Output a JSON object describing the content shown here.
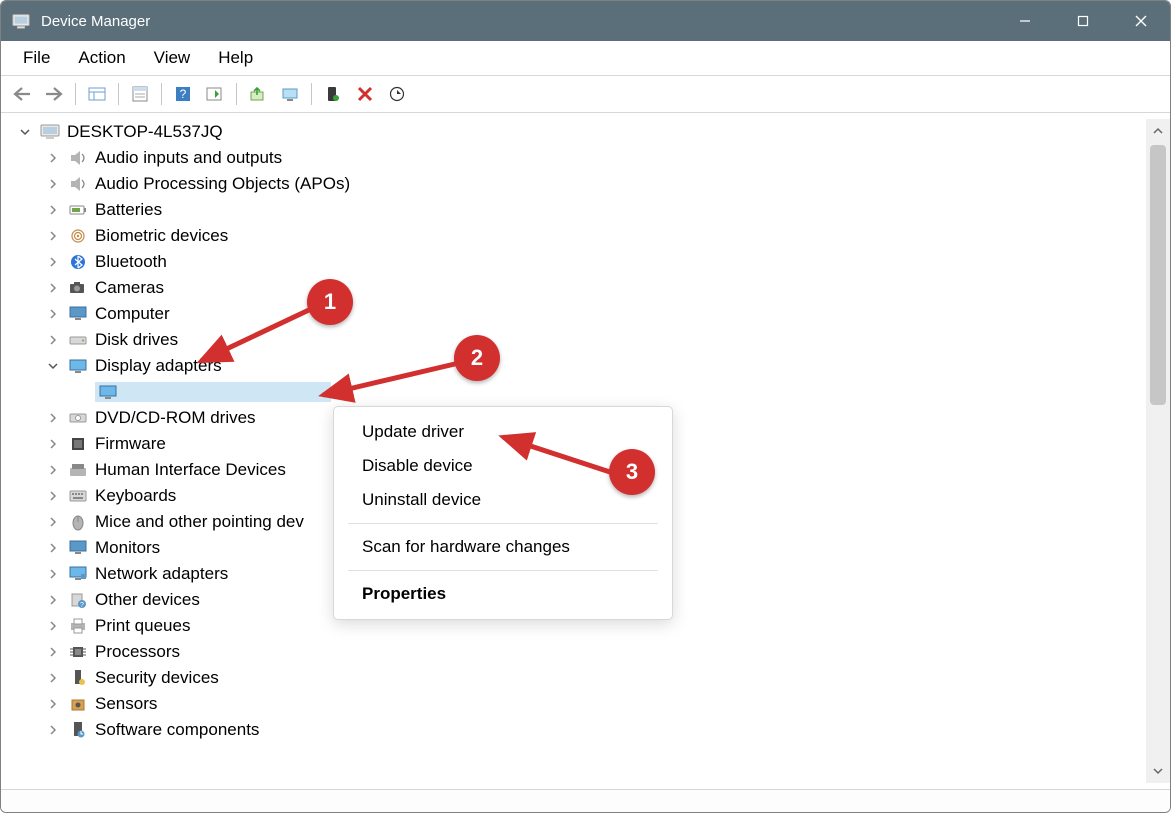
{
  "window": {
    "title": "Device Manager"
  },
  "menus": {
    "file": "File",
    "action": "Action",
    "view": "View",
    "help": "Help"
  },
  "tree": {
    "root": "DESKTOP-4L537JQ",
    "items": [
      "Audio inputs and outputs",
      "Audio Processing Objects (APOs)",
      "Batteries",
      "Biometric devices",
      "Bluetooth",
      "Cameras",
      "Computer",
      "Disk drives",
      "Display adapters",
      "DVD/CD-ROM drives",
      "Firmware",
      "Human Interface Devices",
      "Keyboards",
      "Mice and other pointing dev",
      "Monitors",
      "Network adapters",
      "Other devices",
      "Print queues",
      "Processors",
      "Security devices",
      "Sensors",
      "Software components"
    ],
    "selected_child": ""
  },
  "context_menu": {
    "update": "Update driver",
    "disable": "Disable device",
    "uninstall": "Uninstall device",
    "scan": "Scan for hardware changes",
    "properties": "Properties"
  },
  "badges": {
    "one": "1",
    "two": "2",
    "three": "3"
  }
}
